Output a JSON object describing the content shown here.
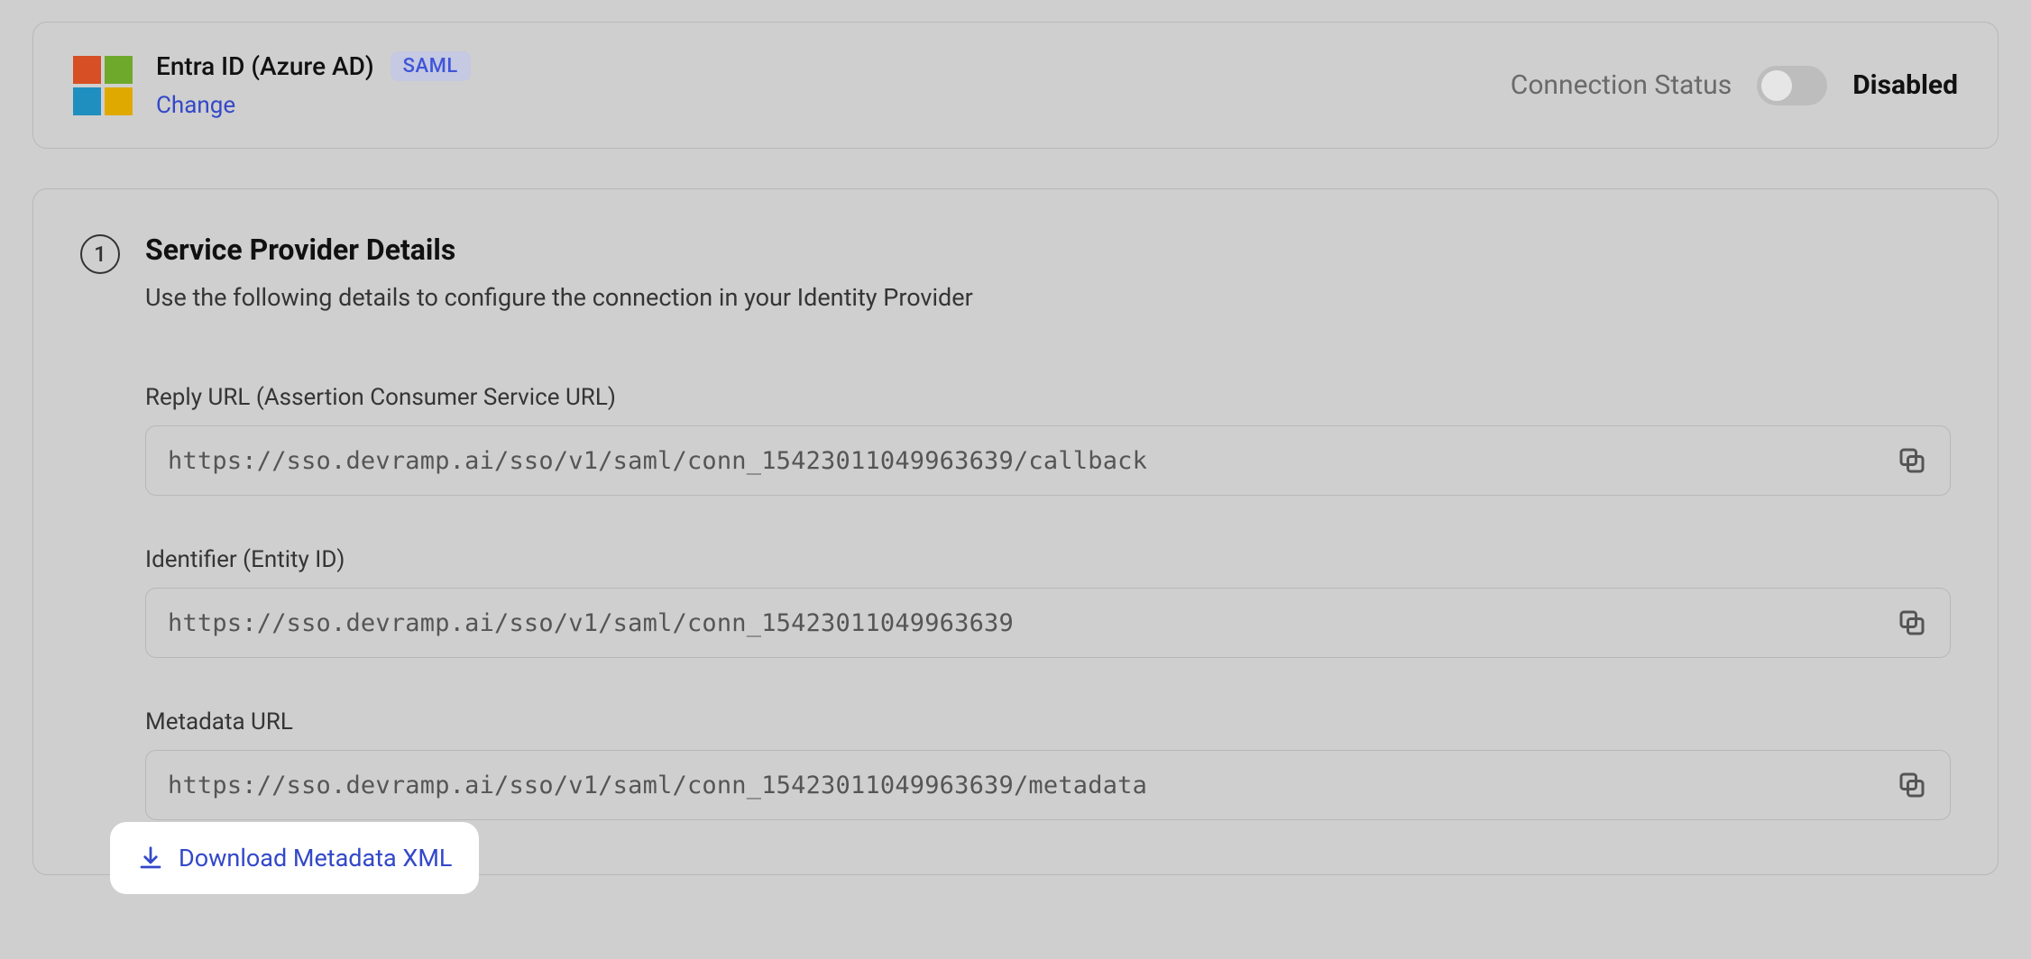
{
  "header": {
    "provider_name": "Entra ID (Azure AD)",
    "badge": "SAML",
    "change_label": "Change",
    "status_label": "Connection Status",
    "status_value": "Disabled",
    "toggle_on": false
  },
  "section": {
    "step_number": "1",
    "title": "Service Provider Details",
    "description": "Use the following details to configure the connection in your Identity Provider"
  },
  "fields": [
    {
      "label": "Reply URL (Assertion Consumer Service URL)",
      "value": "https://sso.devramp.ai/sso/v1/saml/conn_15423011049963639/callback"
    },
    {
      "label": "Identifier (Entity ID)",
      "value": "https://sso.devramp.ai/sso/v1/saml/conn_15423011049963639"
    },
    {
      "label": "Metadata URL",
      "value": "https://sso.devramp.ai/sso/v1/saml/conn_15423011049963639/metadata"
    }
  ],
  "download_link": "Download Metadata XML"
}
